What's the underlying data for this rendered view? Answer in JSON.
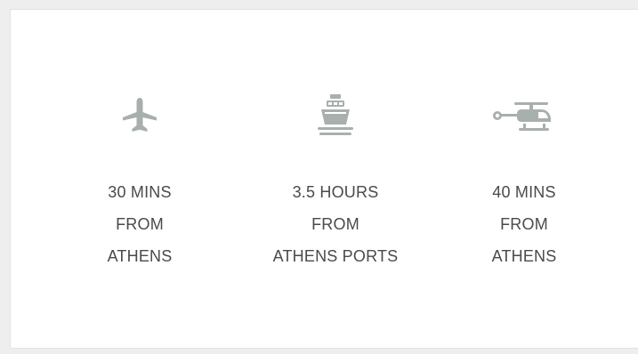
{
  "colors": {
    "icon": "#a8b0ad",
    "text": "#4a4a4a",
    "background": "#eeeeee",
    "card": "#ffffff"
  },
  "items": [
    {
      "icon": "airplane-icon",
      "lines": [
        "30 MINS",
        "FROM",
        "ATHENS"
      ]
    },
    {
      "icon": "ship-icon",
      "lines": [
        "3.5 HOURS",
        "FROM",
        "ATHENS PORTS"
      ]
    },
    {
      "icon": "helicopter-icon",
      "lines": [
        "40 MINS",
        "FROM",
        "ATHENS"
      ]
    }
  ]
}
